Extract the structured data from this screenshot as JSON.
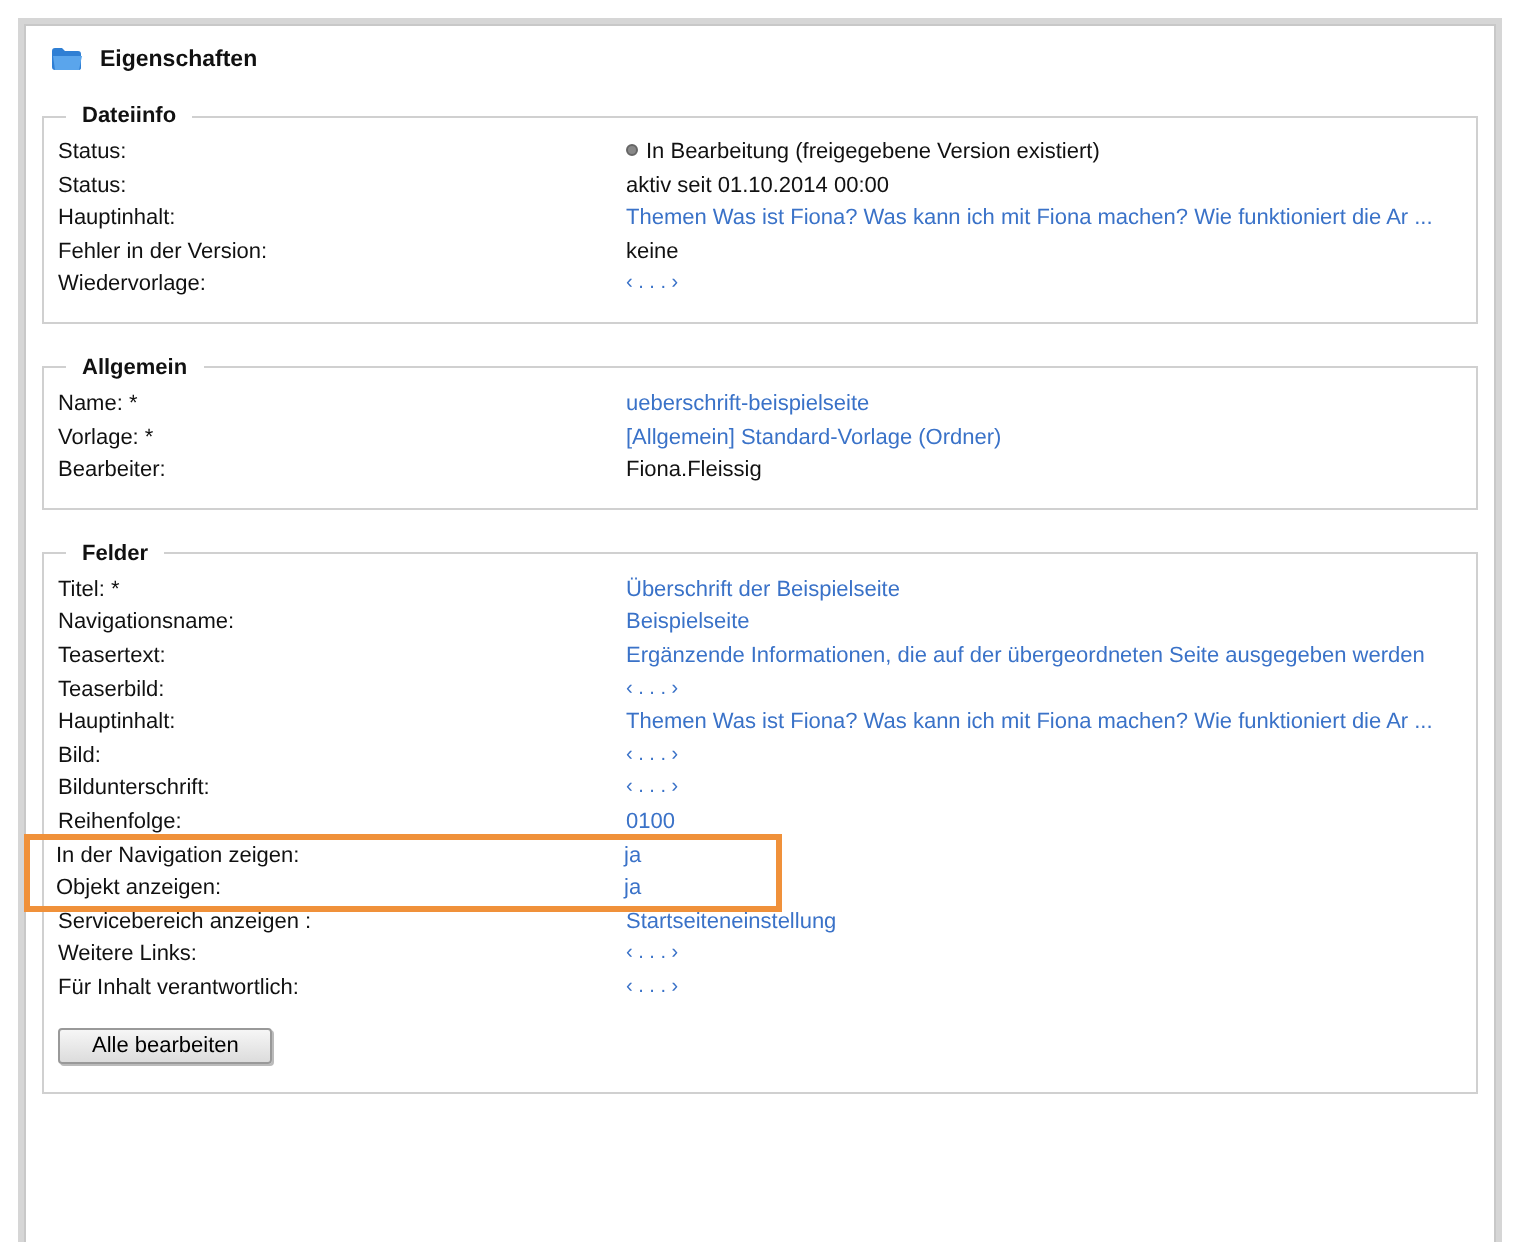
{
  "panel": {
    "title": "Eigenschaften"
  },
  "sections": [
    {
      "legend": "Dateiinfo",
      "rows": [
        {
          "label": "Status:",
          "value": "In Bearbeitung (freigegebene Version existiert)",
          "kind": "status",
          "highlighted": false
        },
        {
          "label": "Status:",
          "value": "aktiv seit 01.10.2014 00:00",
          "kind": "text",
          "highlighted": false
        },
        {
          "label": "Hauptinhalt:",
          "value": "Themen Was ist Fiona? Was kann ich mit Fiona machen? Wie funktioniert die Ar ...",
          "kind": "link",
          "highlighted": false
        },
        {
          "label": "Fehler in der Version:",
          "value": "keine",
          "kind": "text",
          "highlighted": false
        },
        {
          "label": "Wiedervorlage:",
          "value": "‹ . . . ›",
          "kind": "placeholder",
          "highlighted": false
        }
      ]
    },
    {
      "legend": "Allgemein",
      "rows": [
        {
          "label": "Name: *",
          "value": "ueberschrift-beispielseite",
          "kind": "link",
          "highlighted": false
        },
        {
          "label": "Vorlage: *",
          "value": "[Allgemein] Standard-Vorlage (Ordner)",
          "kind": "link",
          "highlighted": false
        },
        {
          "label": "Bearbeiter:",
          "value": "Fiona.Fleissig",
          "kind": "text",
          "highlighted": false
        }
      ]
    },
    {
      "legend": "Felder",
      "rows": [
        {
          "label": "Titel: *",
          "value": "Überschrift der Beispielseite",
          "kind": "link",
          "highlighted": false
        },
        {
          "label": "Navigationsname:",
          "value": "Beispielseite",
          "kind": "link",
          "highlighted": false
        },
        {
          "label": "Teasertext:",
          "value": "Ergänzende Informationen, die auf der übergeordneten Seite ausgegeben werden",
          "kind": "link",
          "highlighted": false
        },
        {
          "label": "Teaserbild:",
          "value": "‹ . . . ›",
          "kind": "placeholder",
          "highlighted": false
        },
        {
          "label": "Hauptinhalt:",
          "value": "Themen Was ist Fiona? Was kann ich mit Fiona machen? Wie funktioniert die Ar ...",
          "kind": "link",
          "highlighted": false
        },
        {
          "label": "Bild:",
          "value": "‹ . . . ›",
          "kind": "placeholder",
          "highlighted": false
        },
        {
          "label": "Bildunterschrift:",
          "value": "‹ . . . ›",
          "kind": "placeholder",
          "highlighted": false
        },
        {
          "label": "Reihenfolge:",
          "value": "0100",
          "kind": "link",
          "highlighted": false
        },
        {
          "label": "In der Navigation zeigen:",
          "value": "ja",
          "kind": "link",
          "highlighted": true
        },
        {
          "label": "Objekt anzeigen:",
          "value": "ja",
          "kind": "link",
          "highlighted": true
        },
        {
          "label": "Servicebereich anzeigen :",
          "value": "Startseiteneinstellung",
          "kind": "link",
          "highlighted": false
        },
        {
          "label": "Weitere Links:",
          "value": "‹ . . . ›",
          "kind": "placeholder",
          "highlighted": false
        },
        {
          "label": "Für Inhalt verantwortlich:",
          "value": "‹ . . . ›",
          "kind": "placeholder",
          "highlighted": false
        }
      ],
      "button": "Alle bearbeiten"
    }
  ]
}
